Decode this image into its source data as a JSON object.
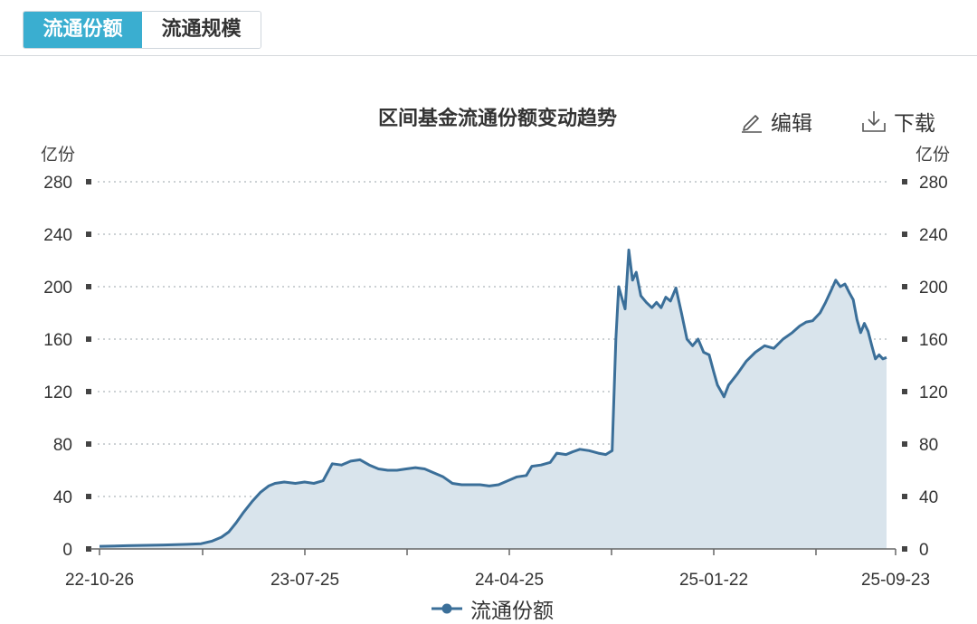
{
  "tabs": [
    {
      "label": "流通份额",
      "active": true
    },
    {
      "label": "流通规模",
      "active": false
    }
  ],
  "toolbar": {
    "edit_label": "编辑",
    "download_label": "下载"
  },
  "colors": {
    "accent": "#3aaed0",
    "line": "#3b6f99",
    "fill": "#d9e4ec"
  },
  "chart_data": {
    "type": "area",
    "title": "区间基金流通份额变动趋势",
    "ylabel_left": "亿份",
    "ylabel_right": "亿份",
    "ylim": [
      0,
      280
    ],
    "yticks": [
      "0",
      "40",
      "80",
      "120",
      "160",
      "200",
      "240",
      "280"
    ],
    "xticks": [
      "22-10-26",
      "23-07-25",
      "24-04-25",
      "25-01-22",
      "25-09-23"
    ],
    "grid": true,
    "legend_position": "bottom-center",
    "series": [
      {
        "name": "流通份额",
        "points": [
          [
            0,
            2
          ],
          [
            30,
            2.5
          ],
          [
            70,
            3
          ],
          [
            95,
            3.5
          ],
          [
            110,
            4
          ],
          [
            122,
            6
          ],
          [
            132,
            9
          ],
          [
            140,
            13
          ],
          [
            148,
            20
          ],
          [
            156,
            28
          ],
          [
            165,
            36
          ],
          [
            174,
            43
          ],
          [
            183,
            48
          ],
          [
            190,
            50
          ],
          [
            200,
            51
          ],
          [
            212,
            50
          ],
          [
            222,
            51
          ],
          [
            232,
            50
          ],
          [
            242,
            52
          ],
          [
            252,
            65
          ],
          [
            262,
            64
          ],
          [
            272,
            67
          ],
          [
            282,
            68
          ],
          [
            292,
            64
          ],
          [
            302,
            61
          ],
          [
            312,
            60
          ],
          [
            322,
            60
          ],
          [
            332,
            61
          ],
          [
            342,
            62
          ],
          [
            352,
            61
          ],
          [
            362,
            58
          ],
          [
            372,
            55
          ],
          [
            382,
            50
          ],
          [
            392,
            49
          ],
          [
            402,
            49
          ],
          [
            412,
            49
          ],
          [
            422,
            48
          ],
          [
            432,
            49
          ],
          [
            442,
            52
          ],
          [
            452,
            55
          ],
          [
            462,
            56
          ],
          [
            468,
            63
          ],
          [
            478,
            64
          ],
          [
            488,
            66
          ],
          [
            495,
            73
          ],
          [
            505,
            72
          ],
          [
            512,
            74
          ],
          [
            520,
            76
          ],
          [
            530,
            75
          ],
          [
            540,
            73
          ],
          [
            548,
            72
          ],
          [
            555,
            75
          ],
          [
            559,
            160
          ],
          [
            562,
            200
          ],
          [
            566,
            190
          ],
          [
            569,
            183
          ],
          [
            573,
            228
          ],
          [
            577,
            205
          ],
          [
            581,
            211
          ],
          [
            586,
            193
          ],
          [
            592,
            188
          ],
          [
            598,
            184
          ],
          [
            603,
            188
          ],
          [
            608,
            184
          ],
          [
            613,
            192
          ],
          [
            618,
            189
          ],
          [
            624,
            199
          ],
          [
            630,
            180
          ],
          [
            636,
            160
          ],
          [
            642,
            155
          ],
          [
            648,
            160
          ],
          [
            654,
            150
          ],
          [
            660,
            148
          ],
          [
            665,
            135
          ],
          [
            669,
            125
          ],
          [
            673,
            120
          ],
          [
            676,
            116
          ],
          [
            681,
            125
          ],
          [
            690,
            133
          ],
          [
            700,
            143
          ],
          [
            710,
            150
          ],
          [
            720,
            155
          ],
          [
            730,
            153
          ],
          [
            740,
            160
          ],
          [
            750,
            165
          ],
          [
            758,
            170
          ],
          [
            765,
            173
          ],
          [
            772,
            174
          ],
          [
            780,
            180
          ],
          [
            786,
            188
          ],
          [
            792,
            197
          ],
          [
            797,
            205
          ],
          [
            802,
            200
          ],
          [
            807,
            202
          ],
          [
            812,
            195
          ],
          [
            816,
            190
          ],
          [
            820,
            175
          ],
          [
            824,
            165
          ],
          [
            828,
            172
          ],
          [
            832,
            166
          ],
          [
            836,
            155
          ],
          [
            840,
            145
          ],
          [
            844,
            148
          ],
          [
            848,
            145
          ],
          [
            852,
            146
          ]
        ]
      }
    ]
  }
}
